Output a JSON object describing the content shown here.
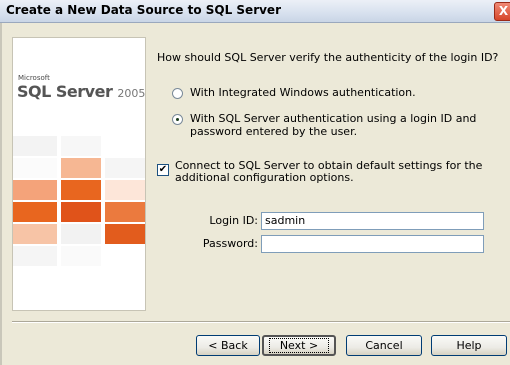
{
  "window": {
    "title": "Create a New Data Source to SQL Server",
    "close_glyph": "X"
  },
  "logo": {
    "vendor": "Microsoft",
    "product": "SQL Server",
    "version": "2005",
    "accent_color": "#e8661f"
  },
  "auth": {
    "question": "How should SQL Server verify the authenticity of the login ID?",
    "options": [
      {
        "label": "With Integrated Windows authentication.",
        "selected": false
      },
      {
        "label": "With SQL Server authentication using a login ID and password entered by the user.",
        "selected": true
      }
    ]
  },
  "connect_option": {
    "label": "Connect to SQL Server to obtain default settings for the additional configuration options.",
    "checked": true,
    "check_glyph": "✔"
  },
  "fields": {
    "login_id": {
      "label": "Login ID:",
      "value": "sadmin"
    },
    "password": {
      "label": "Password:",
      "value": ""
    }
  },
  "buttons": {
    "back": "< Back",
    "next": "Next >",
    "cancel": "Cancel",
    "help": "Help"
  }
}
